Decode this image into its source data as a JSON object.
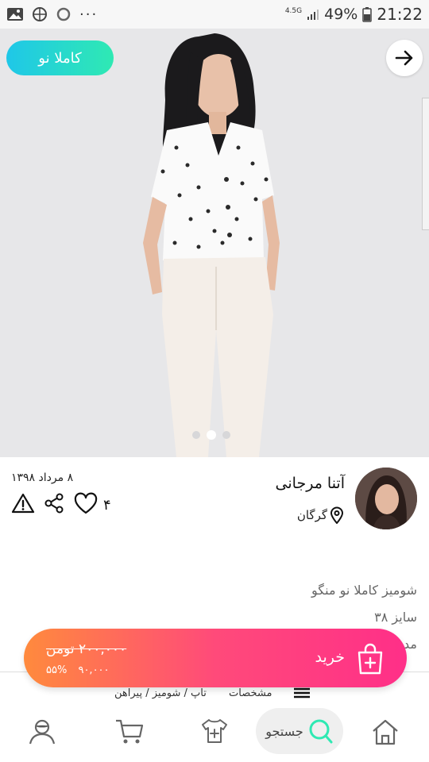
{
  "status_bar": {
    "network": "4.5G",
    "battery": "49%",
    "time": "21:22"
  },
  "product": {
    "badge": "کاملا نو",
    "image_count": 3,
    "active_image": 2
  },
  "seller": {
    "name": "آتنا مرجانی",
    "city": "گرگان"
  },
  "post": {
    "date": "۸ مرداد ۱۳۹۸",
    "likes": "۴"
  },
  "description": {
    "title": "شومیز کاملا نو منگو",
    "size": "سایز ۳۸",
    "extra": "مد"
  },
  "buy": {
    "label": "خرید",
    "old_price": "۲۰۰,۰۰۰ تومن",
    "discount": "۵۵%",
    "new_price": "۹۰,۰۰۰"
  },
  "details": {
    "label": "مشخصات",
    "path": "تاپ / شومیز / پیراهن"
  },
  "nav": {
    "search_label": "جستجو"
  },
  "colors": {
    "badge_gradient": [
      "#1fc7e8",
      "#2fe9b3"
    ],
    "buy_gradient": [
      "#ff8a3d",
      "#ff2f88"
    ],
    "search_accent": "#2fe9b3"
  }
}
